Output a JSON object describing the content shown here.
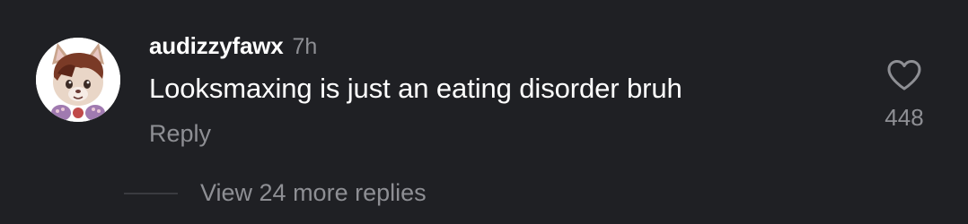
{
  "comment": {
    "username": "audizzyfawx",
    "timestamp": "7h",
    "text": "Looksmaxing is just an eating disorder bruh",
    "reply_label": "Reply",
    "like_count": "448",
    "like_icon": "heart-outline-icon",
    "view_replies_label": "View 24 more replies"
  },
  "colors": {
    "background": "#1f2024",
    "primary_text": "#ffffff",
    "secondary_text": "#8e8f94"
  }
}
